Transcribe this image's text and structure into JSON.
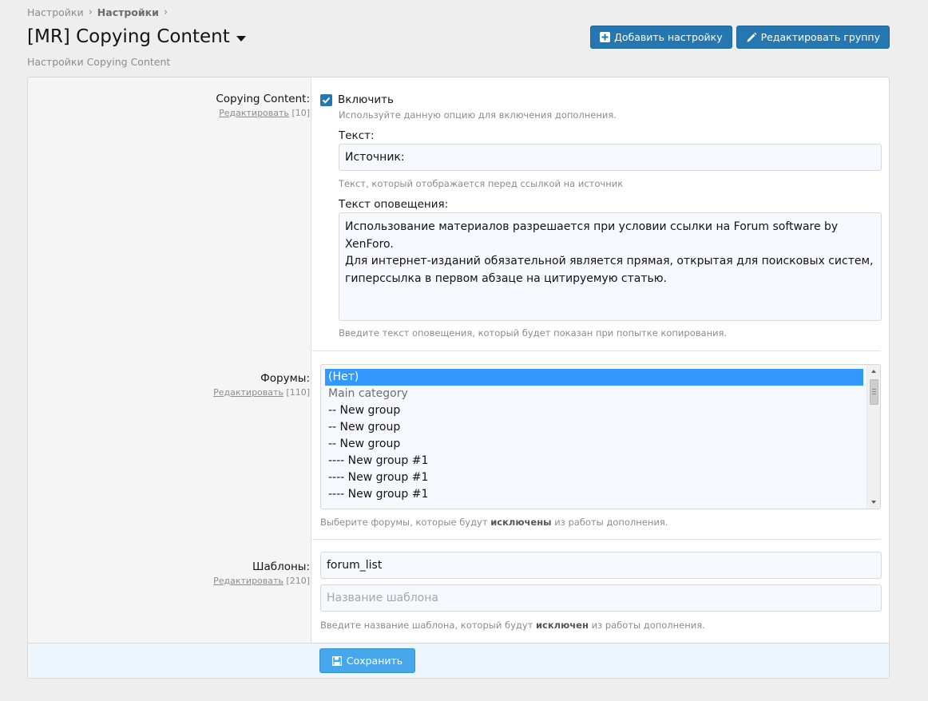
{
  "breadcrumb": [
    {
      "label": "Настройки"
    },
    {
      "label": "Настройки"
    }
  ],
  "header": {
    "title": "[MR] Copying Content",
    "description": "Настройки Copying Content",
    "add_button": "Добавить настройку",
    "edit_group_button": "Редактировать группу"
  },
  "options": {
    "copying": {
      "label": "Copying Content:",
      "edit_link": "Редактировать",
      "order": "[10]",
      "enable_label": "Включить",
      "enable_checked": true,
      "enable_hint": "Используйте данную опцию для включения дополнения.",
      "text_label": "Текст:",
      "text_value": "Источник:",
      "text_hint": "Текст, который отображается перед ссылкой на источник",
      "notice_label": "Текст оповещения:",
      "notice_lines": [
        "Использование материалов разрешается при условии ссылки на Forum software by XenForo.",
        "Для интернет-изданий обязательной является прямая, открытая для поисковых систем,",
        "гиперссылка в первом абзаце на цитируемую статью."
      ],
      "notice_hint": "Введите текст оповещения, который будет показан при попытке копирования."
    },
    "forums": {
      "label": "Форумы:",
      "edit_link": "Редактировать",
      "order": "[110]",
      "list": [
        "(Нет)",
        "Main category",
        "-- New group",
        "-- New group",
        "-- New group",
        "---- New group #1",
        "---- New group #1",
        "---- New group #1"
      ],
      "hint_before": "Выберите форумы, которые будут",
      "hint_bold": "исключены",
      "hint_after": "из работы дополнения."
    },
    "templates": {
      "label": "Шаблоны:",
      "edit_link": "Редактировать",
      "order": "[210]",
      "value": "forum_list",
      "placeholder": "Название шаблона",
      "hint_before": "Введите название шаблона, который будут",
      "hint_bold": "исключен",
      "hint_after": "из работы дополнения."
    }
  },
  "footer": {
    "save_button": "Сохранить"
  },
  "colors": {
    "primary": "#2577b1",
    "save": "#47a7eb",
    "selected_option": "#3399ff"
  },
  "icons": {
    "add": "plus-square-icon",
    "edit": "pencil-icon",
    "save": "floppy-disk-icon",
    "checkbox": "check-icon",
    "title_menu": "caret-down-icon"
  }
}
